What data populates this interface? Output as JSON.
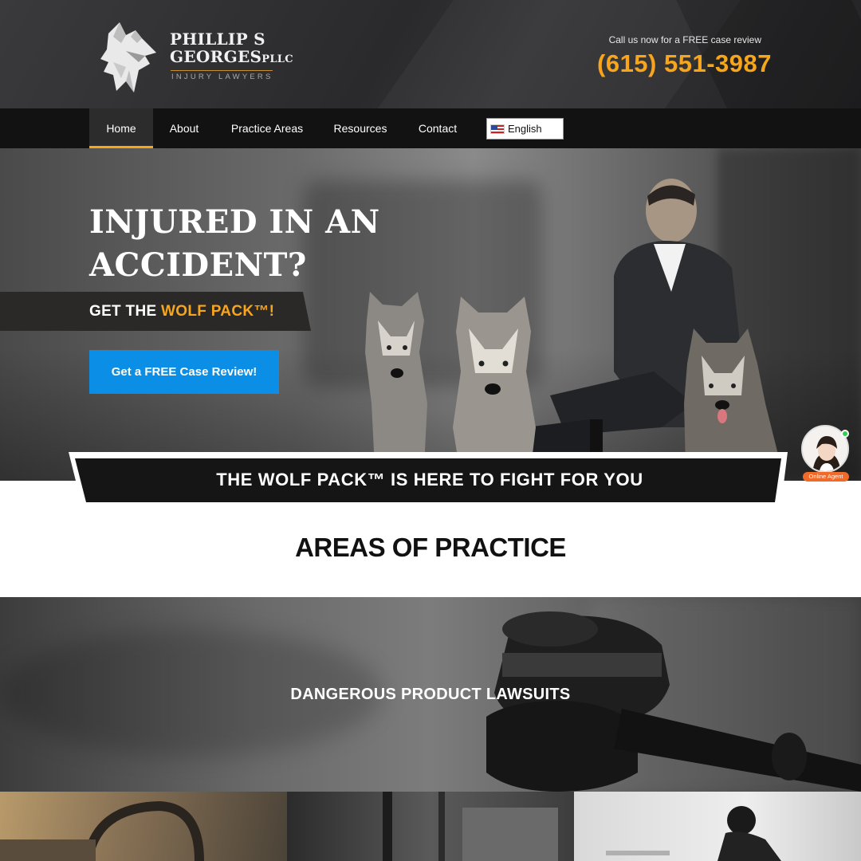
{
  "header": {
    "logo_line1": "PHILLIP S",
    "logo_line2": "GEORGES",
    "logo_suffix": "PLLC",
    "logo_tagline": "INJURY LAWYERS",
    "call_text": "Call us now for a FREE case review",
    "phone": "(615) 551-3987"
  },
  "nav": {
    "items": [
      {
        "label": "Home",
        "active": true
      },
      {
        "label": "About"
      },
      {
        "label": "Practice Areas"
      },
      {
        "label": "Resources"
      },
      {
        "label": "Contact"
      }
    ],
    "language": "English"
  },
  "hero": {
    "headline": "INJURED IN AN ACCIDENT?",
    "tagline_prefix": "GET THE",
    "tagline_accent": "WOLF PACK™!",
    "cta": "Get a FREE Case Review!",
    "banner": "THE WOLF PACK™ IS HERE TO FIGHT FOR YOU"
  },
  "chat_widget": {
    "label": "Online Agent"
  },
  "areas": {
    "title": "AREAS OF PRACTICE",
    "featured": "DANGEROUS PRODUCT LAWSUITS"
  },
  "colors": {
    "accent": "#f7a51b",
    "cta_blue": "#0b8fe6",
    "nav_bg": "#121212"
  }
}
